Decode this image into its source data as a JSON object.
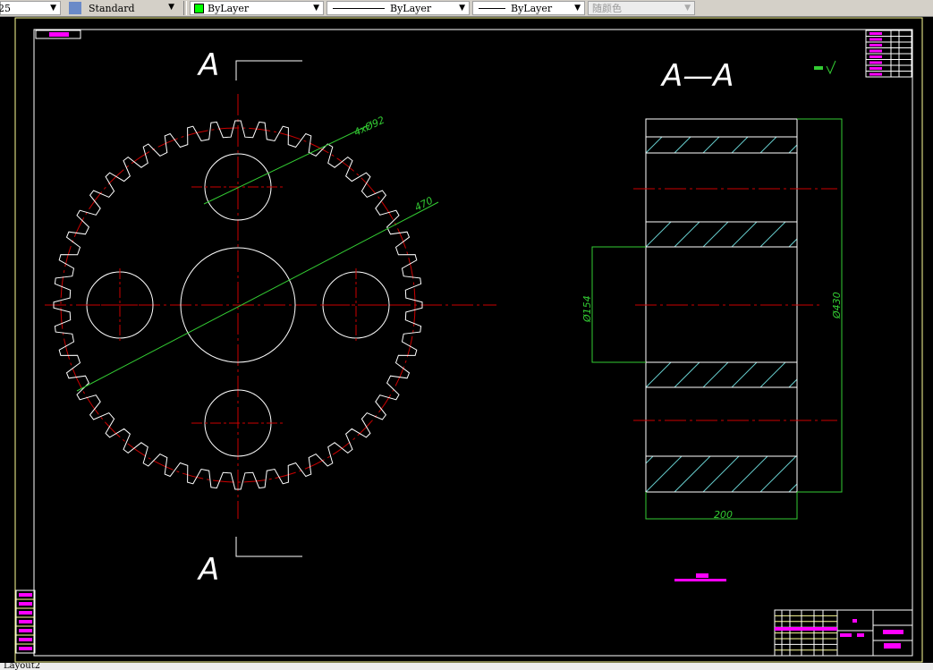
{
  "toolbar": {
    "scale_value": "25",
    "text_style": "Standard",
    "layer_color": "ByLayer",
    "linetype": "ByLayer",
    "lineweight": "ByLayer",
    "plot_style": "随颜色",
    "color_swatch": "#00ff00",
    "icons": [
      "text-style-icon",
      "dropdown-arrow-icon"
    ]
  },
  "drawing": {
    "section_label_left_top": "A",
    "section_label_left_bottom": "A",
    "section_view_title": "A—A",
    "dimensions": {
      "holes": "4xØ92",
      "hole_circle": "470",
      "bore": "Ø154",
      "outer": "Ø430",
      "width": "200"
    },
    "colors": {
      "outline": "#ffffff",
      "centerline": "#cc0000",
      "dimension": "#33cc33",
      "annotation": "#ff00ff",
      "frame": "#ffff99",
      "hatch": "#66cccc"
    },
    "gear_teeth": 48
  },
  "layout_tab": "Layout2"
}
